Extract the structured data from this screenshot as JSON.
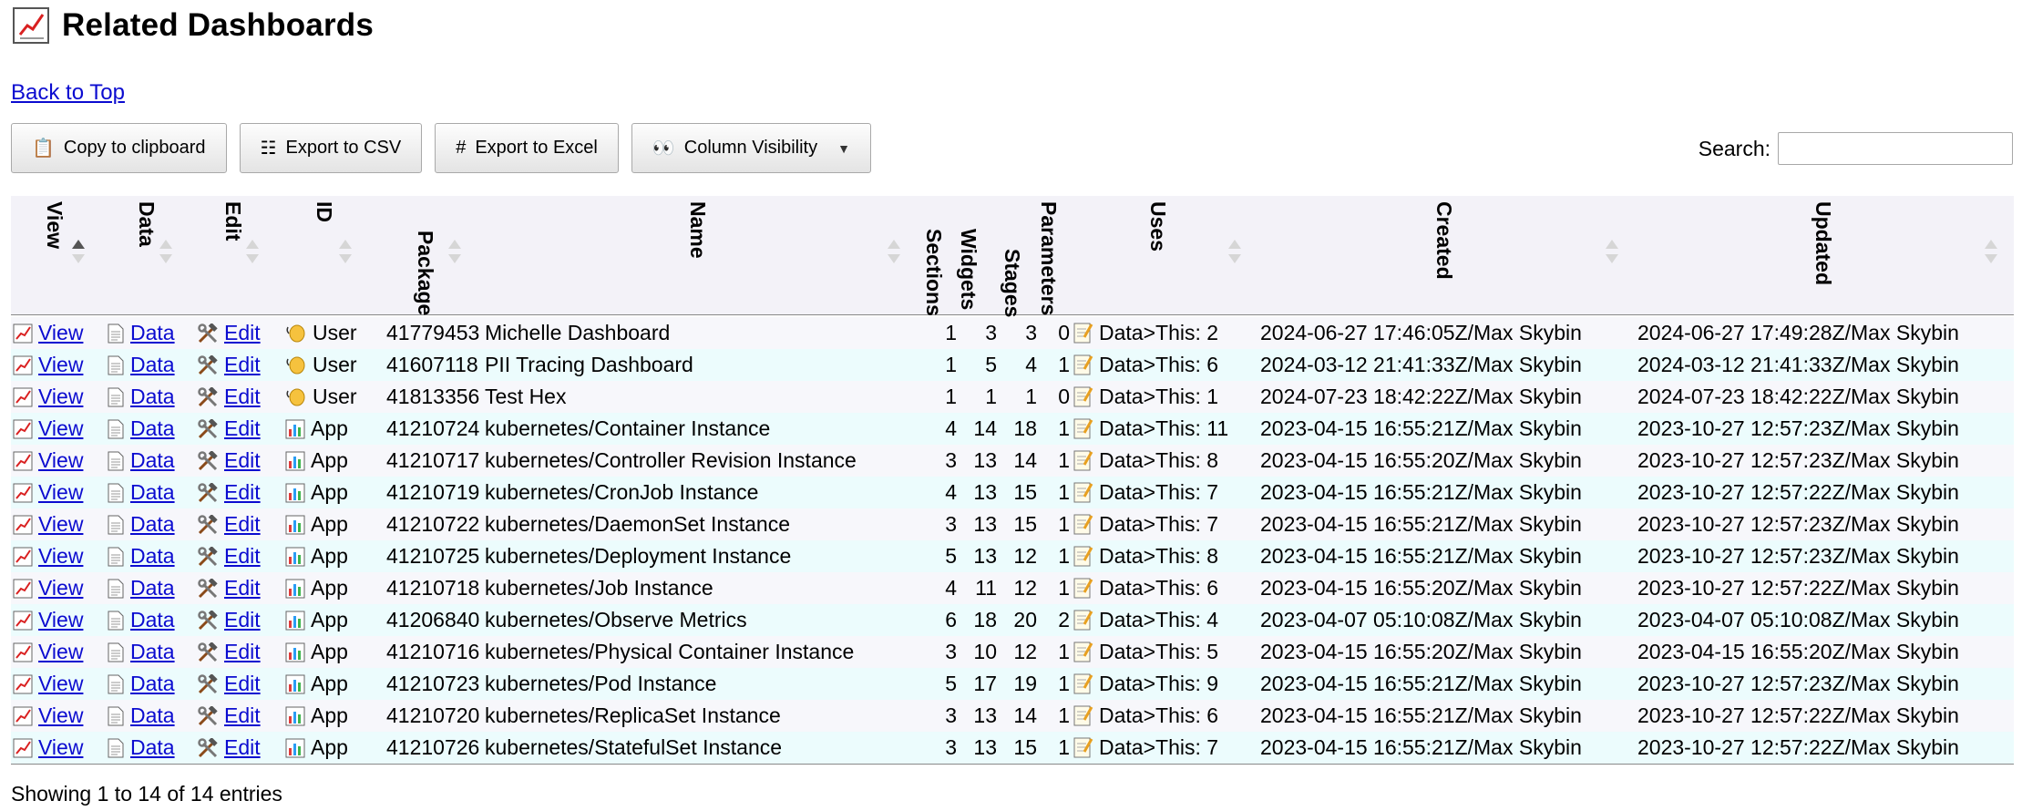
{
  "title": "Related Dashboards",
  "back_link": "Back to Top",
  "buttons": {
    "copy": "Copy to clipboard",
    "csv": "Export to CSV",
    "excel": "Export to Excel",
    "columns": "Column Visibility"
  },
  "search": {
    "label": "Search:",
    "value": "",
    "placeholder": ""
  },
  "columns": {
    "view": "View",
    "data": "Data",
    "edit": "Edit",
    "id": "ID",
    "package": "Package",
    "name": "Name",
    "sections": "Sections",
    "widgets": "Widgets",
    "stages": "Stages",
    "parameters": "Parameters",
    "uses": "Uses",
    "created": "Created",
    "updated": "Updated"
  },
  "sorted_column": "View",
  "link_labels": {
    "view": "View",
    "data": "Data",
    "edit": "Edit"
  },
  "rows": [
    {
      "kind": "User",
      "id": "41779453",
      "name": "Michelle Dashboard",
      "sections": "1",
      "widgets": "3",
      "stages": "3",
      "parameters": "0",
      "uses": "Data>This: 2",
      "created": "2024-06-27 17:46:05Z/Max Skybin",
      "updated": "2024-06-27 17:49:28Z/Max Skybin"
    },
    {
      "kind": "User",
      "id": "41607118",
      "name": "PII Tracing Dashboard",
      "sections": "1",
      "widgets": "5",
      "stages": "4",
      "parameters": "1",
      "uses": "Data>This: 6",
      "created": "2024-03-12 21:41:33Z/Max Skybin",
      "updated": "2024-03-12 21:41:33Z/Max Skybin"
    },
    {
      "kind": "User",
      "id": "41813356",
      "name": "Test Hex",
      "sections": "1",
      "widgets": "1",
      "stages": "1",
      "parameters": "0",
      "uses": "Data>This: 1",
      "created": "2024-07-23 18:42:22Z/Max Skybin",
      "updated": "2024-07-23 18:42:22Z/Max Skybin"
    },
    {
      "kind": "App",
      "id": "41210724",
      "name": "kubernetes/Container Instance",
      "sections": "4",
      "widgets": "14",
      "stages": "18",
      "parameters": "1",
      "uses": "Data>This: 11",
      "created": "2023-04-15 16:55:21Z/Max Skybin",
      "updated": "2023-10-27 12:57:23Z/Max Skybin"
    },
    {
      "kind": "App",
      "id": "41210717",
      "name": "kubernetes/Controller Revision Instance",
      "sections": "3",
      "widgets": "13",
      "stages": "14",
      "parameters": "1",
      "uses": "Data>This: 8",
      "created": "2023-04-15 16:55:20Z/Max Skybin",
      "updated": "2023-10-27 12:57:23Z/Max Skybin"
    },
    {
      "kind": "App",
      "id": "41210719",
      "name": "kubernetes/CronJob Instance",
      "sections": "4",
      "widgets": "13",
      "stages": "15",
      "parameters": "1",
      "uses": "Data>This: 7",
      "created": "2023-04-15 16:55:21Z/Max Skybin",
      "updated": "2023-10-27 12:57:22Z/Max Skybin"
    },
    {
      "kind": "App",
      "id": "41210722",
      "name": "kubernetes/DaemonSet Instance",
      "sections": "3",
      "widgets": "13",
      "stages": "15",
      "parameters": "1",
      "uses": "Data>This: 7",
      "created": "2023-04-15 16:55:21Z/Max Skybin",
      "updated": "2023-10-27 12:57:23Z/Max Skybin"
    },
    {
      "kind": "App",
      "id": "41210725",
      "name": "kubernetes/Deployment Instance",
      "sections": "5",
      "widgets": "13",
      "stages": "12",
      "parameters": "1",
      "uses": "Data>This: 8",
      "created": "2023-04-15 16:55:21Z/Max Skybin",
      "updated": "2023-10-27 12:57:23Z/Max Skybin"
    },
    {
      "kind": "App",
      "id": "41210718",
      "name": "kubernetes/Job Instance",
      "sections": "4",
      "widgets": "11",
      "stages": "12",
      "parameters": "1",
      "uses": "Data>This: 6",
      "created": "2023-04-15 16:55:20Z/Max Skybin",
      "updated": "2023-10-27 12:57:22Z/Max Skybin"
    },
    {
      "kind": "App",
      "id": "41206840",
      "name": "kubernetes/Observe Metrics",
      "sections": "6",
      "widgets": "18",
      "stages": "20",
      "parameters": "2",
      "uses": "Data>This: 4",
      "created": "2023-04-07 05:10:08Z/Max Skybin",
      "updated": "2023-04-07 05:10:08Z/Max Skybin"
    },
    {
      "kind": "App",
      "id": "41210716",
      "name": "kubernetes/Physical Container Instance",
      "sections": "3",
      "widgets": "10",
      "stages": "12",
      "parameters": "1",
      "uses": "Data>This: 5",
      "created": "2023-04-15 16:55:20Z/Max Skybin",
      "updated": "2023-04-15 16:55:20Z/Max Skybin"
    },
    {
      "kind": "App",
      "id": "41210723",
      "name": "kubernetes/Pod Instance",
      "sections": "5",
      "widgets": "17",
      "stages": "19",
      "parameters": "1",
      "uses": "Data>This: 9",
      "created": "2023-04-15 16:55:21Z/Max Skybin",
      "updated": "2023-10-27 12:57:23Z/Max Skybin"
    },
    {
      "kind": "App",
      "id": "41210720",
      "name": "kubernetes/ReplicaSet Instance",
      "sections": "3",
      "widgets": "13",
      "stages": "14",
      "parameters": "1",
      "uses": "Data>This: 6",
      "created": "2023-04-15 16:55:21Z/Max Skybin",
      "updated": "2023-10-27 12:57:22Z/Max Skybin"
    },
    {
      "kind": "App",
      "id": "41210726",
      "name": "kubernetes/StatefulSet Instance",
      "sections": "3",
      "widgets": "13",
      "stages": "15",
      "parameters": "1",
      "uses": "Data>This: 7",
      "created": "2023-04-15 16:55:21Z/Max Skybin",
      "updated": "2023-10-27 12:57:22Z/Max Skybin"
    }
  ],
  "info": "Showing 1 to 14 of 14 entries",
  "icons": {
    "title": "chart-increasing-icon",
    "view": "chart-increasing-icon",
    "data": "document-icon",
    "edit": "hammer-wrench-icon",
    "user": "waving-hand-icon",
    "app": "bar-chart-icon",
    "uses": "memo-icon",
    "copy": "clipboard-icon",
    "csv": "list-icon",
    "excel": "grid-icon",
    "columns": "eyes-icon"
  }
}
